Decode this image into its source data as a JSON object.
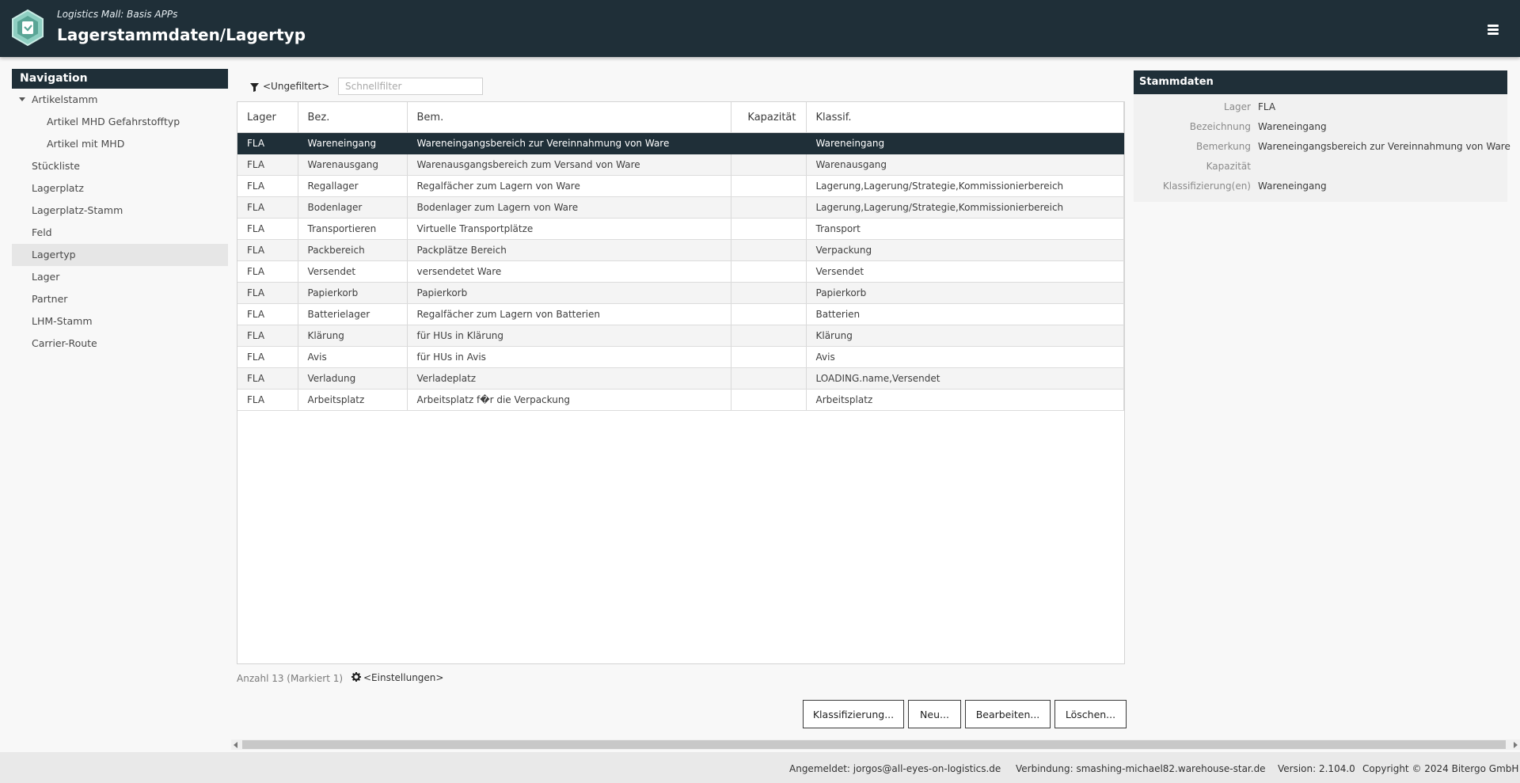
{
  "header": {
    "subtitle": "Logistics Mall: Basis APPs",
    "title": "Lagerstammdaten/Lagertyp"
  },
  "nav": {
    "title": "Navigation",
    "items": [
      {
        "label": "Artikelstamm",
        "level": 1,
        "expanded": true
      },
      {
        "label": "Artikel MHD Gefahrstofftyp",
        "level": 2
      },
      {
        "label": "Artikel mit MHD",
        "level": 2
      },
      {
        "label": "Stückliste",
        "level": 1
      },
      {
        "label": "Lagerplatz",
        "level": 1
      },
      {
        "label": "Lagerplatz-Stamm",
        "level": 1
      },
      {
        "label": "Feld",
        "level": 1
      },
      {
        "label": "Lagertyp",
        "level": 1,
        "active": true
      },
      {
        "label": "Lager",
        "level": 1
      },
      {
        "label": "Partner",
        "level": 1
      },
      {
        "label": "LHM-Stamm",
        "level": 1
      },
      {
        "label": "Carrier-Route",
        "level": 1
      }
    ]
  },
  "filter": {
    "label": "<Ungefiltert>",
    "placeholder": "Schnellfilter"
  },
  "table": {
    "columns": [
      "Lager",
      "Bez.",
      "Bem.",
      "Kapazität",
      "Klassif."
    ],
    "rows": [
      [
        "FLA",
        "Wareneingang",
        "Wareneingangsbereich zur Vereinnahmung von Ware",
        "",
        "Wareneingang"
      ],
      [
        "FLA",
        "Warenausgang",
        "Warenausgangsbereich zum Versand von Ware",
        "",
        "Warenausgang"
      ],
      [
        "FLA",
        "Regallager",
        "Regalfächer zum Lagern von Ware",
        "",
        "Lagerung,Lagerung/Strategie,Kommissionierbereich"
      ],
      [
        "FLA",
        "Bodenlager",
        "Bodenlager zum Lagern von Ware",
        "",
        "Lagerung,Lagerung/Strategie,Kommissionierbereich"
      ],
      [
        "FLA",
        "Transportieren",
        "Virtuelle Transportplätze",
        "",
        "Transport"
      ],
      [
        "FLA",
        "Packbereich",
        "Packplätze Bereich",
        "",
        "Verpackung"
      ],
      [
        "FLA",
        "Versendet",
        "versendetet Ware",
        "",
        "Versendet"
      ],
      [
        "FLA",
        "Papierkorb",
        "Papierkorb",
        "",
        "Papierkorb"
      ],
      [
        "FLA",
        "Batterielager",
        "Regalfächer zum Lagern von Batterien",
        "",
        "Batterien"
      ],
      [
        "FLA",
        "Klärung",
        "für HUs in Klärung",
        "",
        "Klärung"
      ],
      [
        "FLA",
        "Avis",
        "für HUs in Avis",
        "",
        "Avis"
      ],
      [
        "FLA",
        "Verladung",
        "Verladeplatz",
        "",
        "LOADING.name,Versendet"
      ],
      [
        "FLA",
        "Arbeitsplatz",
        "Arbeitsplatz f�r die Verpackung",
        "",
        "Arbeitsplatz"
      ]
    ],
    "selected_row": 0
  },
  "count_text": "Anzahl 13 (Markiert 1)",
  "settings_label": "<Einstellungen>",
  "buttons": {
    "classify": "Klassifizierung...",
    "new": "Neu...",
    "edit": "Bearbeiten...",
    "delete": "Löschen..."
  },
  "details": {
    "title": "Stammdaten",
    "fields": [
      {
        "label": "Lager",
        "value": "FLA"
      },
      {
        "label": "Bezeichnung",
        "value": "Wareneingang"
      },
      {
        "label": "Bemerkung",
        "value": "Wareneingangsbereich zur Vereinnahmung von Ware"
      },
      {
        "label": "Kapazität",
        "value": ""
      },
      {
        "label": "Klassifizierung(en)",
        "value": "Wareneingang"
      }
    ]
  },
  "footer": {
    "user": "Angemeldet: jorgos@all-eyes-on-logistics.de",
    "connection": "Verbindung: smashing-michael82.warehouse-star.de",
    "version": "Version: 2.104.0",
    "copyright": "Copyright © 2024 Bitergo GmbH"
  },
  "colors": {
    "header_bg": "#1f2f38",
    "selected_row_bg": "#1f2f38",
    "logo_accent": "#6fb7a8"
  }
}
